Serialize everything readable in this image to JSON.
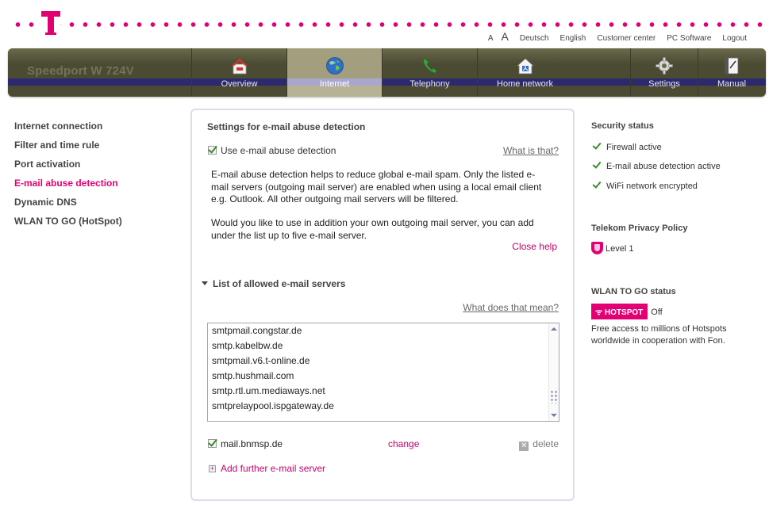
{
  "top_links": {
    "font_small": "A",
    "font_large": "A",
    "deutsch": "Deutsch",
    "english": "English",
    "customer_center": "Customer center",
    "pc_software": "PC Software",
    "logout": "Logout"
  },
  "brand": "Speedport W 724V",
  "nav_tabs": [
    {
      "label": "Overview",
      "icon": "house-icon"
    },
    {
      "label": "Internet",
      "icon": "globe-icon",
      "active": true
    },
    {
      "label": "Telephony",
      "icon": "phone-icon"
    },
    {
      "label": "Home network",
      "icon": "home-network-icon"
    },
    {
      "label": "Settings",
      "icon": "gear-icon"
    },
    {
      "label": "Manual",
      "icon": "manual-icon"
    }
  ],
  "sidebar": [
    "Internet connection",
    "Filter and time rule",
    "Port activation",
    "E-mail abuse detection",
    "Dynamic DNS",
    "WLAN TO GO (HotSpot)"
  ],
  "main": {
    "title": "Settings for e-mail abuse detection",
    "use_label": "Use e-mail abuse detection",
    "what_is_that": "What is that?",
    "help_p1": "E-mail abuse detection helps to reduce global e-mail spam. Only the listed e-mail servers (outgoing mail server) are enabled when using a local email client e.g. Outlook. All other outgoing mail servers will be filtered.",
    "help_p2": "Would you like to use in addition your own outgoing mail server, you can add under the list up to five e-mail server.",
    "close_help": "Close help",
    "list_header": "List of allowed e-mail servers",
    "what_does_that_mean": "What does that mean?",
    "servers": [
      "smtpmail.congstar.de",
      "smtp.kabelbw.de",
      "smtpmail.v6.t-online.de",
      "smtp.hushmail.com",
      "smtp.rtl.um.mediaways.net",
      "smtprelaypool.ispgateway.de"
    ],
    "custom_server": "mail.bnmsp.de",
    "change": "change",
    "delete": "delete",
    "add_server": "Add further e-mail server"
  },
  "right": {
    "security_title": "Security status",
    "security_items": [
      "Firewall active",
      "E-mail abuse detection active",
      "WiFi network encrypted"
    ],
    "privacy_title": "Telekom Privacy Policy",
    "privacy_level": "Level 1",
    "wlan_title": "WLAN TO GO status",
    "hotspot_badge": "HOTSPOT",
    "hotspot_state": "Off",
    "hotspot_desc": "Free access to millions of Hotspots worldwide in cooperation with Fon."
  },
  "colors": {
    "magenta": "#e20074",
    "nav_bg": "#4b4a33",
    "nav_band": "#2c2a6e",
    "check_green": "#3a8a2a"
  }
}
